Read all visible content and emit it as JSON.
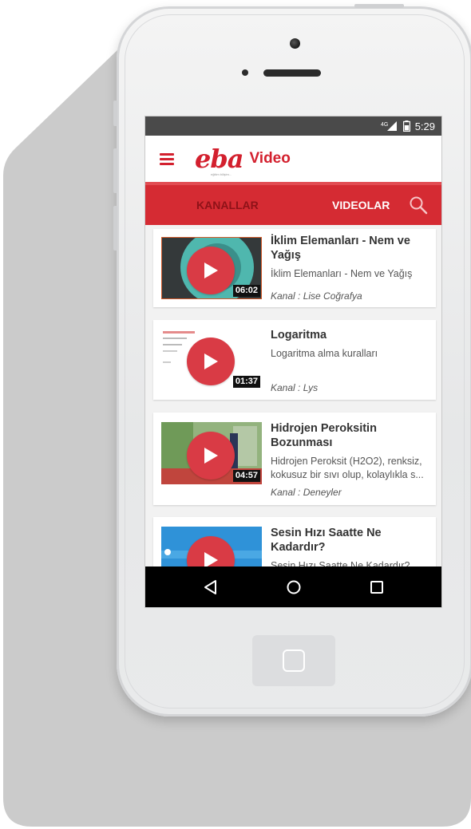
{
  "status_bar": {
    "network": "4G",
    "time": "5:29"
  },
  "app_bar": {
    "logo": "eba",
    "logo_tagline": "eğitim bilişim...",
    "title": "Video"
  },
  "tabs": [
    {
      "label": "KANALLAR",
      "active": false
    },
    {
      "label": "VIDEOLAR",
      "active": true
    }
  ],
  "videos": [
    {
      "title": "İklim Elemanları - Nem ve Yağış",
      "description": "İklim Elemanları - Nem ve Yağış",
      "channel": "Kanal : Lise Coğrafya",
      "duration": "06:02"
    },
    {
      "title": "Logaritma",
      "description": "Logaritma alma kuralları",
      "channel": "Kanal : Lys",
      "duration": "01:37"
    },
    {
      "title": "Hidrojen Peroksitin Bozunması",
      "description": "Hidrojen Peroksit (H2O2), renksiz, kokusuz bir sıvı olup, kolaylıkla s...",
      "channel": "Kanal : Deneyler",
      "duration": "04:57"
    },
    {
      "title": "Sesin Hızı Saatte Ne Kadardır?",
      "description": "Sesin Hızı Saatte Ne Kadardır?",
      "channel": "",
      "duration": ""
    }
  ],
  "icons": {
    "menu": "hamburger-icon",
    "search": "search-icon",
    "fab": "archive-icon",
    "nav_back": "back-triangle-icon",
    "nav_home": "home-circle-icon",
    "nav_recents": "recents-square-icon",
    "hardware_home": "home-button-icon"
  },
  "colors": {
    "brand_red": "#d52b33",
    "tab_inactive": "#8e1218",
    "status_bar": "#4a4a4a",
    "nav_bar": "#000000"
  }
}
